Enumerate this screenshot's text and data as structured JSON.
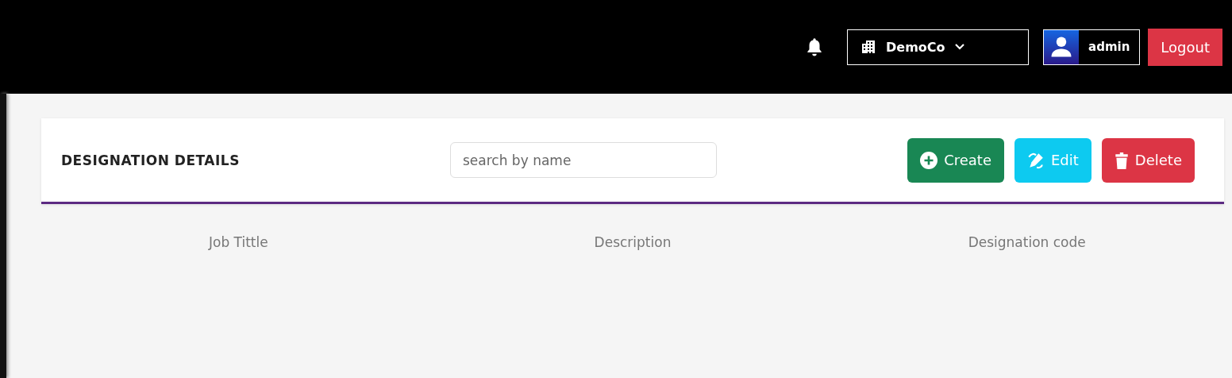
{
  "header": {
    "company": "DemoCo",
    "user": "admin",
    "logout": "Logout"
  },
  "card": {
    "title": "DESIGNATION DETAILS",
    "search": {
      "placeholder": "search by name"
    },
    "buttons": [
      {
        "kind": "create",
        "label": "Create"
      },
      {
        "kind": "edit",
        "label": "Edit"
      },
      {
        "kind": "delete",
        "label": "Delete"
      }
    ]
  },
  "table": {
    "columns": [
      "Job Tittle",
      "Description",
      "Designation code"
    ]
  }
}
